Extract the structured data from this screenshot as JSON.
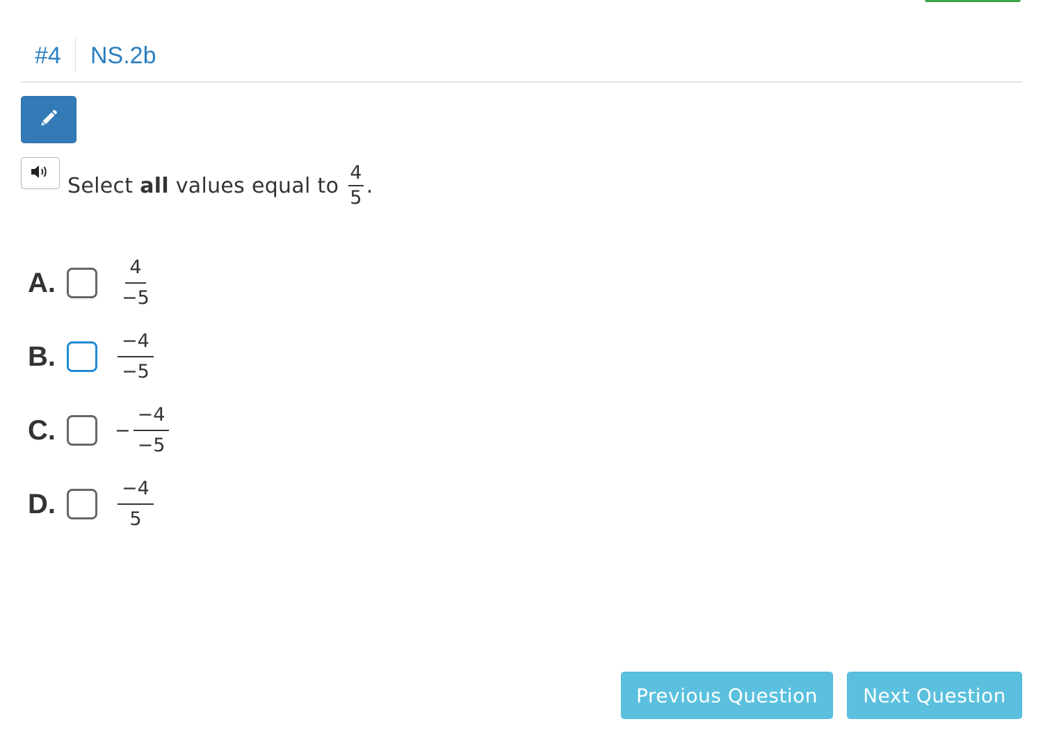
{
  "header": {
    "question_number": "#4",
    "standard": "NS.2b"
  },
  "toolbar": {
    "edit_icon": "pencil-icon",
    "audio_icon": "speaker-icon"
  },
  "question": {
    "prefix": "Select ",
    "bold": "all",
    "suffix": " values equal to",
    "fraction_num": "4",
    "fraction_den": "5",
    "end": "."
  },
  "options": [
    {
      "letter": "A.",
      "sign": "",
      "num": "4",
      "den": "−5",
      "checked": false
    },
    {
      "letter": "B.",
      "sign": "",
      "num": "−4",
      "den": "−5",
      "checked": false
    },
    {
      "letter": "C.",
      "sign": "−",
      "num": "−4",
      "den": "−5",
      "checked": false
    },
    {
      "letter": "D.",
      "sign": "",
      "num": "−4",
      "den": "5",
      "checked": false
    }
  ],
  "nav": {
    "previous_label": "Previous Question",
    "next_label": "Next Question"
  },
  "colors": {
    "link_blue": "#2a7fc0",
    "primary_button": "#337ab7",
    "info_button": "#5bc0de",
    "focus_border": "#1f8ad3",
    "top_accent": "#3aa543"
  }
}
